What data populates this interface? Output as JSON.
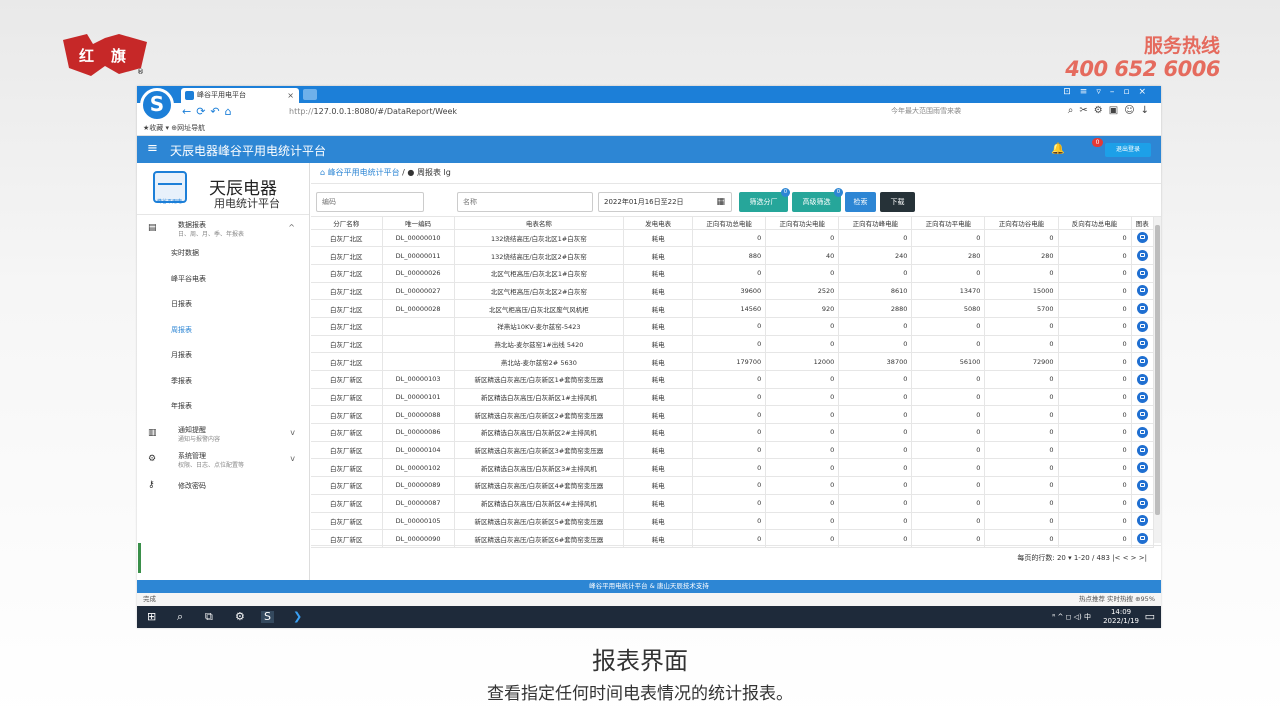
{
  "hotline": {
    "title": "服务热线",
    "number": "400 652 6006"
  },
  "browser": {
    "tab_title": "峰谷平用电平台",
    "url_prefix": "http://",
    "url": "127.0.0.1:8080/#/DataReport/Week",
    "search_hint": "今年最大范围雨雪来袭",
    "favorites": "★收藏 ▾   ⊕网址导航"
  },
  "app": {
    "title": "天辰电器峰谷平用电统计平台",
    "notification_count": "0",
    "logout_label": "退出登录"
  },
  "sidebar": {
    "brand_name": "天辰电器",
    "brand_desc": "用电统计平台",
    "brand_icon_text": "峰谷平用电",
    "report_group": {
      "label": "数据报表",
      "desc": "日、周、月、季、年报表"
    },
    "report_items": [
      "实时数据",
      "峰平谷电表",
      "日报表",
      "周报表",
      "月报表",
      "季报表",
      "年报表"
    ],
    "notice": {
      "label": "通知提醒",
      "desc": "通知与报警内容"
    },
    "system": {
      "label": "系统管理",
      "desc": "权限、日志、点位配置等"
    },
    "password": {
      "label": "修改密码"
    }
  },
  "breadcrumb": {
    "home": "峰谷平用电统计平台",
    "separator": "/",
    "current": "周报表 lg"
  },
  "filters": {
    "code_placeholder": "编码",
    "name_placeholder": "名称",
    "date_range": "2022年01月16日至22日",
    "btn_factory": "筛选分厂",
    "btn_factory_badge": "0",
    "btn_advanced": "高级筛选",
    "btn_advanced_badge": "0",
    "btn_search": "检索",
    "btn_download": "下载"
  },
  "table": {
    "headers": [
      "分厂名称",
      "唯一编码",
      "电表名称",
      "发电电表",
      "正向有功总电能",
      "正向有功尖电能",
      "正向有功峰电能",
      "正向有功平电能",
      "正向有功谷电能",
      "反向有功总电能",
      "图表"
    ],
    "rows": [
      [
        "白灰厂北区",
        "DL_00000010",
        "132烧结高压/白灰北区1#白灰窑",
        "耗电",
        "0",
        "0",
        "0",
        "0",
        "0",
        "0"
      ],
      [
        "白灰厂北区",
        "DL_00000011",
        "132烧结高压/白灰北区2#白灰窑",
        "耗电",
        "880",
        "40",
        "240",
        "280",
        "280",
        "0"
      ],
      [
        "白灰厂北区",
        "DL_00000026",
        "北区气柜高压/白灰北区1#白灰窑",
        "耗电",
        "0",
        "0",
        "0",
        "0",
        "0",
        "0"
      ],
      [
        "白灰厂北区",
        "DL_00000027",
        "北区气柜高压/白灰北区2#白灰窑",
        "耗电",
        "39600",
        "2520",
        "8610",
        "13470",
        "15000",
        "0"
      ],
      [
        "白灰厂北区",
        "DL_00000028",
        "北区气柜高压/白灰北区废气风机柜",
        "耗电",
        "14560",
        "920",
        "2880",
        "5080",
        "5700",
        "0"
      ],
      [
        "白灰厂北区",
        "",
        "祥燕站10KV-麦尔兹窑-5423",
        "耗电",
        "0",
        "0",
        "0",
        "0",
        "0",
        "0"
      ],
      [
        "白灰厂北区",
        "",
        "燕北站-麦尔兹窑1#出线 5420",
        "耗电",
        "0",
        "0",
        "0",
        "0",
        "0",
        "0"
      ],
      [
        "白灰厂北区",
        "",
        "燕北站-麦尔兹窑2# 5630",
        "耗电",
        "179700",
        "12000",
        "38700",
        "56100",
        "72900",
        "0"
      ],
      [
        "白灰厂新区",
        "DL_00000103",
        "新区精选白灰高压/白灰新区1#套筒窑变压器",
        "耗电",
        "0",
        "0",
        "0",
        "0",
        "0",
        "0"
      ],
      [
        "白灰厂新区",
        "DL_00000101",
        "新区精选白灰高压/白灰新区1#主排风机",
        "耗电",
        "0",
        "0",
        "0",
        "0",
        "0",
        "0"
      ],
      [
        "白灰厂新区",
        "DL_00000088",
        "新区精选白灰高压/白灰新区2#套筒窑变压器",
        "耗电",
        "0",
        "0",
        "0",
        "0",
        "0",
        "0"
      ],
      [
        "白灰厂新区",
        "DL_00000086",
        "新区精选白灰高压/白灰新区2#主排风机",
        "耗电",
        "0",
        "0",
        "0",
        "0",
        "0",
        "0"
      ],
      [
        "白灰厂新区",
        "DL_00000104",
        "新区精选白灰高压/白灰新区3#套筒窑变压器",
        "耗电",
        "0",
        "0",
        "0",
        "0",
        "0",
        "0"
      ],
      [
        "白灰厂新区",
        "DL_00000102",
        "新区精选白灰高压/白灰新区3#主排风机",
        "耗电",
        "0",
        "0",
        "0",
        "0",
        "0",
        "0"
      ],
      [
        "白灰厂新区",
        "DL_00000089",
        "新区精选白灰高压/白灰新区4#套筒窑变压器",
        "耗电",
        "0",
        "0",
        "0",
        "0",
        "0",
        "0"
      ],
      [
        "白灰厂新区",
        "DL_00000087",
        "新区精选白灰高压/白灰新区4#主排风机",
        "耗电",
        "0",
        "0",
        "0",
        "0",
        "0",
        "0"
      ],
      [
        "白灰厂新区",
        "DL_00000105",
        "新区精选白灰高压/白灰新区5#套筒窑变压器",
        "耗电",
        "0",
        "0",
        "0",
        "0",
        "0",
        "0"
      ],
      [
        "白灰厂新区",
        "DL_00000090",
        "新区精选白灰高压/白灰新区6#套筒窑变压器",
        "耗电",
        "0",
        "0",
        "0",
        "0",
        "0",
        "0"
      ]
    ]
  },
  "pager": {
    "rows_per_page_label": "每页的行数:",
    "rows_per_page": "20",
    "range": "1-20 / 483",
    "nav": "|<   <   >   >|"
  },
  "footer": {
    "text": "峰谷平用电统计平台 & 唐山天辰技术支持"
  },
  "statusbar": {
    "left": "完成",
    "right": "热点推荐  实时热搜   ⊕95%"
  },
  "taskbar": {
    "time": "14:09",
    "date": "2022/1/19",
    "tray": "ᴿ ^ ◻ ◁) 中"
  },
  "slide": {
    "caption": "报表界面",
    "subcaption": "查看指定任何时间电表情况的统计报表。"
  },
  "colors": {
    "primary": "#2d86d4",
    "teal_button": "#26a69a",
    "dark_button": "#263238",
    "logo_red": "#c62828",
    "hotline": "#e56b5e"
  }
}
